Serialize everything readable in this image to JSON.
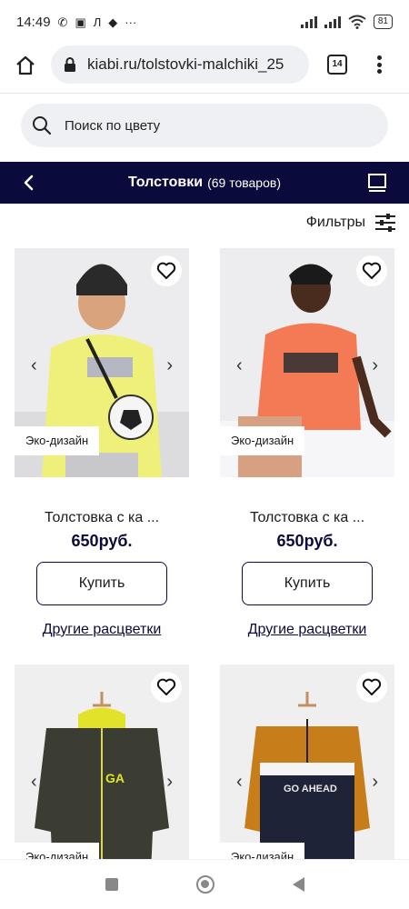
{
  "status_bar": {
    "time": "14:49",
    "extra": "···",
    "battery": "81"
  },
  "browser": {
    "url": "kiabi.ru/tolstovki-malchiki_25",
    "tabs_count": "14"
  },
  "search": {
    "placeholder": "Поиск по цвету"
  },
  "category": {
    "title": "Толстовки",
    "count": "(69 товаров)"
  },
  "filters": {
    "label": "Фильтры"
  },
  "products": [
    {
      "eco_badge": "Эко-дизайн",
      "name": "Толстовка с ка ...",
      "price": "650руб.",
      "buy_label": "Купить",
      "colors_link": "Другие расцветки",
      "image_desc": "boy-yellow-hoodie-with-football-bag"
    },
    {
      "eco_badge": "Эко-дизайн",
      "name": "Толстовка с ка ...",
      "price": "650руб.",
      "buy_label": "Купить",
      "colors_link": "Другие расцветки",
      "image_desc": "boy-orange-hoodie"
    },
    {
      "eco_badge": "Эко-дизайн",
      "image_desc": "dark-green-zip-hoodie-yellow-hood"
    },
    {
      "eco_badge": "Эко-дизайн",
      "image_desc": "orange-black-sweatshirt-go-ahead"
    }
  ],
  "colors": {
    "brand_navy": "#0a0a3c",
    "search_bg": "#eef0f3"
  }
}
